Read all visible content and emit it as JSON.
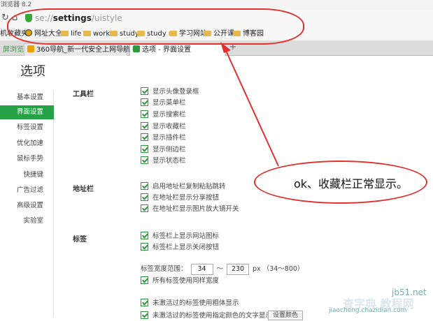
{
  "window": {
    "title": "浏览器 8.2"
  },
  "address": {
    "protocol": "se://",
    "host": "settings",
    "path": "/uistyle"
  },
  "bookmarks": [
    {
      "label": "机收藏夹",
      "icon": "star-icon"
    },
    {
      "label": "网址大全",
      "icon": "globe-icon"
    },
    {
      "label": "life",
      "icon": "folder-icon"
    },
    {
      "label": "work",
      "icon": "folder-icon"
    },
    {
      "label": "study",
      "icon": "folder-icon"
    },
    {
      "label": "study n",
      "icon": "folder-icon"
    },
    {
      "label": "学习网站",
      "icon": "folder-icon"
    },
    {
      "label": "公开课",
      "icon": "folder-icon"
    },
    {
      "label": "博客园",
      "icon": "folder-icon"
    }
  ],
  "tabs": [
    {
      "label": "屏浏览"
    },
    {
      "label": "360导航_新一代安全上网导航",
      "close": "×"
    },
    {
      "label": "选项 - 界面设置"
    }
  ],
  "page": {
    "title": "选项"
  },
  "sidebar": {
    "items": [
      {
        "label": "基本设置"
      },
      {
        "label": "界面设置"
      },
      {
        "label": "标签设置"
      },
      {
        "label": "优化加速"
      },
      {
        "label": "鼠标手势"
      },
      {
        "label": "快捷键"
      },
      {
        "label": "广告过滤"
      },
      {
        "label": "高级设置"
      },
      {
        "label": "实验室"
      }
    ],
    "active_index": 1
  },
  "sections": {
    "toolbar": {
      "heading": "工具栏",
      "options": [
        "显示头像登录框",
        "显示菜单栏",
        "显示搜索栏",
        "显示收藏栏",
        "显示插件栏",
        "显示侧边栏",
        "显示状态栏"
      ]
    },
    "addressbar": {
      "heading": "地址栏",
      "options": [
        "启用地址栏复制粘贴跳转",
        "在地址栏显示分享按钮",
        "在地址栏显示图片放大镜开关"
      ]
    },
    "tabs": {
      "heading": "标签",
      "options": [
        "标签栏上显示网站图标",
        "标签栏上显示关闭按钮"
      ],
      "width_label": "标签宽度范围：",
      "width_min": "34",
      "width_sep": "～",
      "width_max": "230",
      "width_unit": "px （34～800）",
      "same_width": "所有标签使用同样宽度",
      "bold_inactive": "未激活过的标签使用粗体显示",
      "partial_text": "未激活过的标签使用指定颜色的文字显示：",
      "color_button": "设置颜色"
    }
  },
  "annotation": {
    "text": "ok、收藏栏正常显示。",
    "color": "#e23030"
  },
  "watermark": {
    "line1": "查字典",
    "line2": "教程网",
    "url": "jiaocheng.chazidian.com",
    "site": "jb51.net"
  }
}
